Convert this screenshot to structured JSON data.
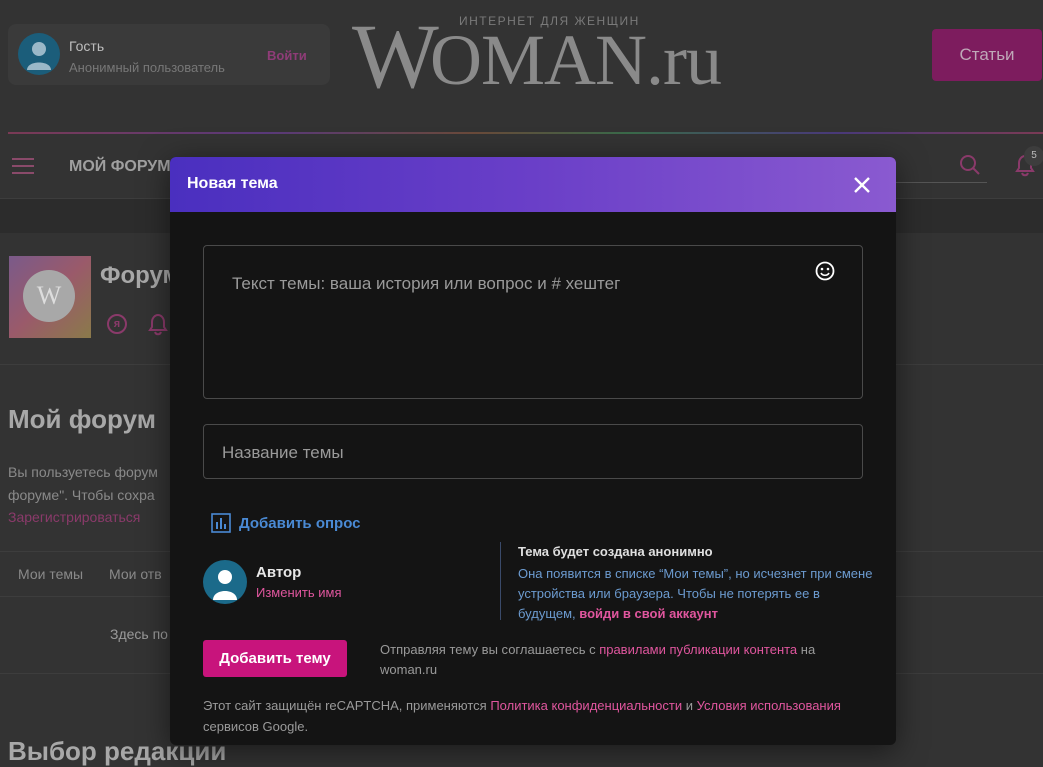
{
  "header": {
    "user": {
      "name": "Гость",
      "status": "Анонимный пользователь",
      "login_label": "Войти"
    },
    "logo": {
      "w": "W",
      "rest": "OMAN.ru",
      "tagline": "ИНТЕРНЕТ ДЛЯ ЖЕНЩИН"
    },
    "articles_label": "Статьи"
  },
  "nav": {
    "my_forum": "МОЙ ФОРУМ",
    "notifications_count": "5"
  },
  "forum": {
    "title": "Форум",
    "thumb_letter": "W",
    "ya_icon": "я"
  },
  "page": {
    "my_forum_heading": "Мой форум",
    "desc_line1": "Вы пользуетесь форум",
    "desc_line2": "форуме\". Чтобы сохра",
    "register_link": "Зарегистрироваться",
    "tab_my_topics": "Мои темы",
    "tab_my_answers": "Мои отв",
    "empty_message": "Здесь по",
    "editors_choice": "Выбор редакции"
  },
  "modal": {
    "title": "Новая тема",
    "text_placeholder": "Текст темы: ваша история или вопрос и # хештег",
    "title_placeholder": "Название темы",
    "add_poll_label": "Добавить опрос",
    "author": {
      "label": "Автор",
      "change_name": "Изменить имя"
    },
    "anon": {
      "title": "Тема будет создана анонимно",
      "text": "Она появится в списке “Мои темы”, но исчезнет при смене устройства или браузера. Чтобы не потерять ее в будущем, ",
      "link": "войди в свой аккаунт"
    },
    "submit_label": "Добавить тему",
    "agree": {
      "prefix": "Отправляя тему вы соглашаетесь с ",
      "link": "правилами публикации контента",
      "suffix": " на woman.ru"
    },
    "captcha": {
      "prefix": "Этот сайт защищён reCAPTCHA, применяются ",
      "privacy": "Политика конфиденциальности",
      "and": " и ",
      "terms": "Условия использования",
      "suffix": " сервисов Google."
    }
  },
  "colors": {
    "accent_pink": "#e0569e",
    "button_pink": "#c8147c",
    "link_blue": "#4a8ad4",
    "header_gradient_start": "#4a2fbf",
    "header_gradient_end": "#8a5ad0"
  },
  "icons": [
    "user-icon",
    "hamburger-icon",
    "search-icon",
    "bell-icon",
    "close-icon",
    "emoji-icon",
    "poll-icon"
  ]
}
